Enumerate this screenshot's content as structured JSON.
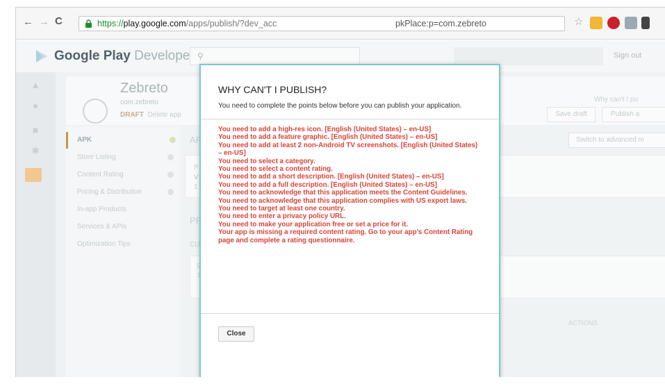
{
  "browser": {
    "url_https": "https://",
    "url_host": "play.google.com",
    "url_path": "/apps/publish/?dev_acc",
    "url_tail": "pkPlace:p=com.zebreto"
  },
  "console": {
    "brand_bold": "Google Play",
    "brand_rest": " Developer Console",
    "sign_out": "Sign out"
  },
  "app": {
    "name": "Zebreto",
    "package": "com.zebreto",
    "status": "DRAFT",
    "status_extra": "Delete app",
    "why_link": "Why can't I pu",
    "save_draft": "Save draft",
    "publish": "Publish a",
    "advanced_mode": "Switch to advanced m"
  },
  "menu": {
    "items": [
      {
        "label": "APK"
      },
      {
        "label": "Store Listing"
      },
      {
        "label": "Content Rating"
      },
      {
        "label": "Pricing & Distribution"
      },
      {
        "label": "In-app Products"
      },
      {
        "label": "Services & APIs"
      },
      {
        "label": "Optimization Tips"
      }
    ]
  },
  "main": {
    "heading_fragment": "AP",
    "section_fragment": "PF",
    "sub_fragment": "CU",
    "card_fragment_1": "P",
    "card_fragment_2": "V",
    "card_fragment_3": "1",
    "card_fragment_4": "9",
    "card_fragment_5": "7",
    "actions_label": "ACTIONS"
  },
  "modal": {
    "title": "WHY CAN'T I PUBLISH?",
    "subtitle": "You need to complete the points below before you can publish your application.",
    "issues": [
      "You need to add a high-res icon. [English (United States) – en-US]",
      "You need to add a feature graphic. [English (United States) – en-US]",
      "You need to add at least 2 non-Android TV screenshots. [English (United States) – en-US]",
      "You need to select a category.",
      "You need to select a content rating.",
      "You need to add a short description. [English (United States) – en-US]",
      "You need to add a full description. [English (United States) – en-US]",
      "You need to acknowledge that this application meets the Content Guidelines.",
      "You need to acknowledge that this application complies with US export laws.",
      "You need to target at least one country.",
      "You need to enter a privacy policy URL.",
      "You need to make your application free or set a price for it.",
      "Your app is missing a required content rating. Go to your app's Content Rating page and complete a rating questionnaire."
    ],
    "close_label": "Close"
  },
  "colors": {
    "issue_text": "#d7453a",
    "modal_border": "#7fc7cf",
    "draft_status": "#c9b08b"
  }
}
